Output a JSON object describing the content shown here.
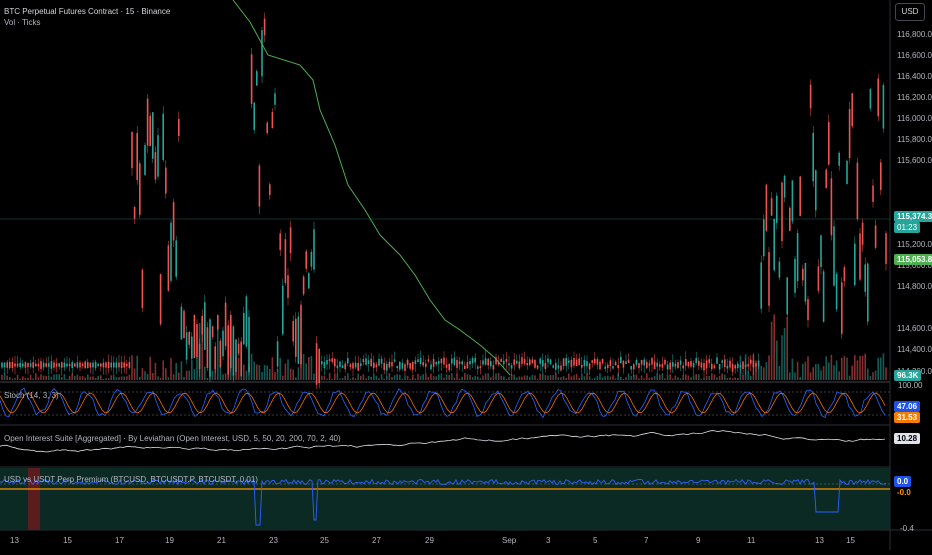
{
  "header": {
    "title": "BTC Perpetual Futures Contract · 15 · Binance",
    "subtitle": "Vol · Ticks"
  },
  "currency_button": "USD",
  "price_axis": {
    "ticks": [
      "116,800.0",
      "116,600.0",
      "116,400.0",
      "116,200.0",
      "116,000.0",
      "115,800.0",
      "115,600.0",
      "115,200.0",
      "115,000.0",
      "114,800.0",
      "114,600.0",
      "114,400.0",
      "114,200.0"
    ],
    "last_price": "115,374.3",
    "countdown": "01:23",
    "green_badge": "115,053.8",
    "volume_badge": "96.3K",
    "stoch_top": "100.00"
  },
  "panes": {
    "stoch": {
      "label": "Stoch (14, 3, 3)",
      "badge_k": "47.06",
      "badge_d": "31.53"
    },
    "open_interest": {
      "label": "Open Interest Suite [Aggregated] · By Leviathan (Open Interest, USD, 5, 50, 20, 200, 70, 2, 40)",
      "badge": "10.28"
    },
    "premium": {
      "label": "USD vs USDT Perp Premium (BTCUSD, BTCUSDT.P, BTCUSDT, 0.01)",
      "badge_top": "0.0",
      "badge_bottom": "-0.0",
      "tick_bottom": "-0.4"
    }
  },
  "time_axis": [
    "13",
    "15",
    "17",
    "19",
    "21",
    "23",
    "25",
    "27",
    "29",
    "Sep",
    "3",
    "5",
    "7",
    "9",
    "11",
    "13",
    "15"
  ],
  "colors": {
    "up": "#26a69a",
    "down": "#ef5350",
    "ma": "#4caf50",
    "stoch_k": "#2962ff",
    "stoch_d": "#ef6c00",
    "oi": "#e0e3eb",
    "premium_line": "#2962ff",
    "premium_orange": "#ff9800",
    "premium_bg": "#0c2a24",
    "badge_blue": "#1e53e5",
    "badge_green": "#26a69a",
    "badge_orange": "#f57c00"
  }
}
